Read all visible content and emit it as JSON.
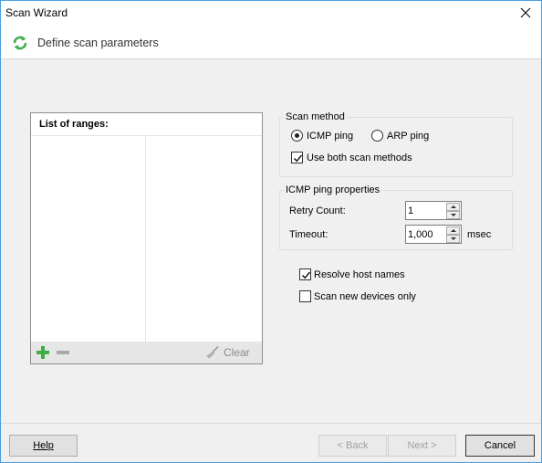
{
  "window": {
    "title": "Scan Wizard"
  },
  "header": {
    "title": "Define scan parameters",
    "icon": "refresh-scan-icon"
  },
  "ranges": {
    "title": "List of ranges:",
    "clear_label": "Clear"
  },
  "scan_method": {
    "legend": "Scan method",
    "icmp_label": "ICMP ping",
    "icmp_selected": true,
    "arp_label": "ARP ping",
    "arp_selected": false,
    "both_label": "Use both scan methods",
    "both_checked": true
  },
  "icmp_props": {
    "legend": "ICMP ping properties",
    "retry_label": "Retry Count:",
    "retry_value": "1",
    "timeout_label": "Timeout:",
    "timeout_value": "1,000",
    "timeout_unit": "msec"
  },
  "options": {
    "resolve_label": "Resolve host names",
    "resolve_checked": true,
    "new_only_label": "Scan new devices only",
    "new_only_checked": false
  },
  "buttons": {
    "help": "Help",
    "back": "< Back",
    "next": "Next >",
    "cancel": "Cancel"
  },
  "colors": {
    "accent_green": "#3fae49",
    "window_border": "#4a9ee0"
  }
}
